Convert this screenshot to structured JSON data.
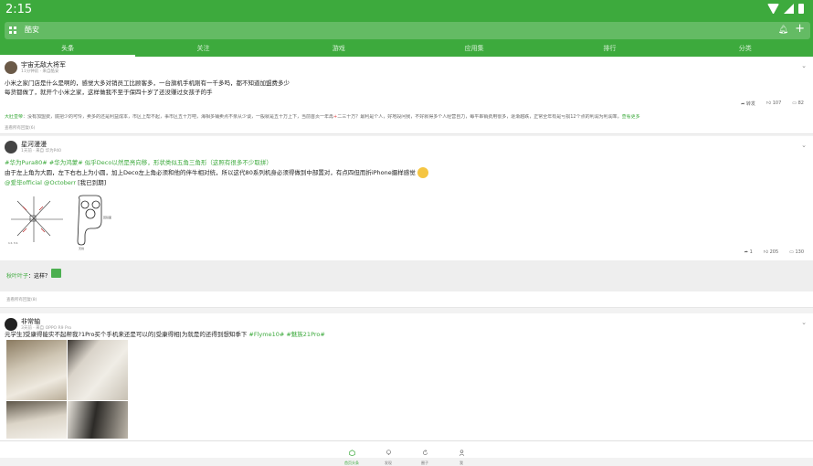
{
  "status_bar": {
    "time": "2:15"
  },
  "app_bar": {
    "search_placeholder": "酷安"
  },
  "tabs": [
    {
      "label": "头条",
      "active": true
    },
    {
      "label": "关注",
      "active": false
    },
    {
      "label": "游戏",
      "active": false
    },
    {
      "label": "应用集",
      "active": false
    },
    {
      "label": "排行",
      "active": false
    },
    {
      "label": "分类",
      "active": false
    }
  ],
  "posts": [
    {
      "username": "宇宙无敌大将军",
      "meta": "11分钟前 · 来自酷安",
      "line1": "小米之家门店是什么是啊的，感觉大多对销员工比顾客多，一台旗机手机刚有一千多吗，都不知道加盟费多少",
      "line2": "每货都做了，就开个小米之家，这样做我不至于保四十岁了还没赚过女孩子的手",
      "stats": {
        "share": "转发",
        "likes": "107",
        "comments": "82"
      },
      "reply": {
        "name": "大肚皇帝",
        "text": "：没有加盟费，底把少的可怜，卖多的还是利益成本，市区上帮不起，事市区五十万吧，海相多铺卖点不亲从少谈，一般就是五十万上下，当前首页一年再",
        "plus": "+",
        "text2": "二三十万？最利是个人，好地段问我，不好就得多个人经营自力，每平串销费用很多，逐渐越跌，正常全年有是亏损12个点的利润为利润率，",
        "more": "查看更多"
      },
      "footer": "查看所有回复(6)"
    },
    {
      "username": "星河漫漫",
      "meta": "1天前 · 来自 华为P40",
      "tags_line": "#华为Pura80# #华为鸿蒙# 似乎Deco以然是亮向移，形状类似五角三角形（这照有很多不少取拼）",
      "line2": "由于左上角为大圆，左下右右上为小圆，加上Deco左上角必须和他的伴牛相对统，所以这代80系列机身必须得做到中部置对，有点四但而折iPhone摄样感觉",
      "line3_tags": "@爱毕official @Octoberr",
      "line3_rest": " [我已到期]",
      "diagram_labels": {
        "a": "1:1 3:1",
        "b": "回镜面",
        "c": "天线"
      },
      "stats": {
        "share": "1",
        "likes": "205",
        "comments": "130"
      },
      "reply_user": "秋叶叶子",
      "reply_text": "：这样？",
      "footer": "查看所有回复(8)"
    },
    {
      "username": "非常轴",
      "meta": "3天前 · 来自 OPPO R9 Pro",
      "text": "元学生]受康得能实不起帮我?1Pro买个手机来还是可以的|受康得相|为就是的还得到想知季下",
      "tags": " #Flyme10# #魅族21Pro#"
    }
  ],
  "bottom_nav": [
    {
      "label": "首页头条",
      "icon": "home-icon",
      "active": true
    },
    {
      "label": "发现",
      "icon": "bulb-icon",
      "active": false
    },
    {
      "label": "圈子",
      "icon": "refresh-icon",
      "active": false
    },
    {
      "label": "我",
      "icon": "person-icon",
      "active": false
    }
  ],
  "colors": {
    "primary": "#3daa3d",
    "primary_light": "#64bb64",
    "link": "#3daa3d"
  }
}
